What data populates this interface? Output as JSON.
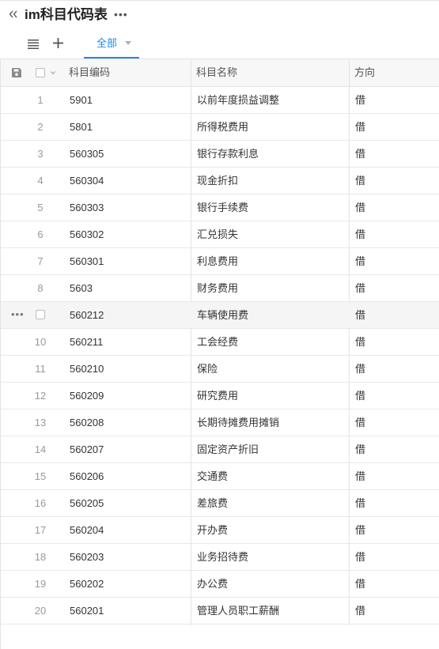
{
  "header": {
    "title": "im科目代码表",
    "more_label": "•••"
  },
  "toolbar": {
    "tab_all_label": "全部"
  },
  "table": {
    "columns": [
      "科目编码",
      "科目名称",
      "方向"
    ],
    "rows": [
      {
        "num": "1",
        "code": "5901",
        "name": "以前年度损益调整",
        "dir": "借"
      },
      {
        "num": "2",
        "code": "5801",
        "name": "所得税费用",
        "dir": "借"
      },
      {
        "num": "3",
        "code": "560305",
        "name": "银行存款利息",
        "dir": "借"
      },
      {
        "num": "4",
        "code": "560304",
        "name": "现金折扣",
        "dir": "借"
      },
      {
        "num": "5",
        "code": "560303",
        "name": "银行手续费",
        "dir": "借"
      },
      {
        "num": "6",
        "code": "560302",
        "name": "汇兑损失",
        "dir": "借"
      },
      {
        "num": "7",
        "code": "560301",
        "name": "利息费用",
        "dir": "借"
      },
      {
        "num": "8",
        "code": "5603",
        "name": "财务费用",
        "dir": "借"
      },
      {
        "num": "9",
        "code": "560212",
        "name": "车辆使用费",
        "dir": "借"
      },
      {
        "num": "10",
        "code": "560211",
        "name": "工会经费",
        "dir": "借"
      },
      {
        "num": "11",
        "code": "560210",
        "name": "保险",
        "dir": "借"
      },
      {
        "num": "12",
        "code": "560209",
        "name": "研究费用",
        "dir": "借"
      },
      {
        "num": "13",
        "code": "560208",
        "name": "长期待摊费用摊销",
        "dir": "借"
      },
      {
        "num": "14",
        "code": "560207",
        "name": "固定资产折旧",
        "dir": "借"
      },
      {
        "num": "15",
        "code": "560206",
        "name": "交通费",
        "dir": "借"
      },
      {
        "num": "16",
        "code": "560205",
        "name": "差旅费",
        "dir": "借"
      },
      {
        "num": "17",
        "code": "560204",
        "name": "开办费",
        "dir": "借"
      },
      {
        "num": "18",
        "code": "560203",
        "name": "业务招待费",
        "dir": "借"
      },
      {
        "num": "19",
        "code": "560202",
        "name": "办公费",
        "dir": "借"
      },
      {
        "num": "20",
        "code": "560201",
        "name": "管理人员职工薪酬",
        "dir": "借"
      }
    ],
    "hover_row_actions": "•••"
  },
  "colors": {
    "accent": "#1e88e5",
    "border": "#e3e3e3",
    "header_bg": "#f7f7f7"
  },
  "icons": {
    "collapse": "double-chevron-left-icon",
    "list": "list-icon",
    "add": "plus-icon",
    "save": "save-icon"
  }
}
